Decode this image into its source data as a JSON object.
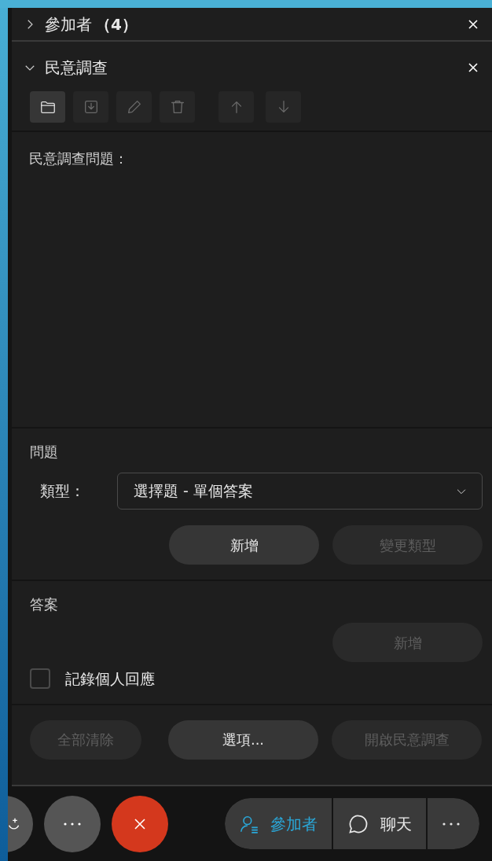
{
  "participants_header": {
    "title": "參加者",
    "count": "（4）",
    "expanded": false
  },
  "poll_header": {
    "title": "民意調查",
    "expanded": true
  },
  "toolbar": [
    {
      "kind": "folder",
      "disabled": false
    },
    {
      "kind": "import",
      "disabled": true
    },
    {
      "kind": "edit",
      "disabled": true
    },
    {
      "kind": "delete",
      "disabled": true
    },
    {
      "kind": "up",
      "disabled": true
    },
    {
      "kind": "down",
      "disabled": true
    }
  ],
  "question_prompt": "民意調查問題：",
  "question": {
    "heading": "問題",
    "type_label": "類型：",
    "type_value": "選擇題 - 單個答案",
    "buttons": [
      {
        "label": "新增",
        "disabled": false
      },
      {
        "label": "變更類型",
        "disabled": true
      }
    ]
  },
  "answers": {
    "heading": "答案",
    "add_button": {
      "label": "新增",
      "disabled": true
    },
    "record_checkbox": {
      "label": "記錄個人回應",
      "checked": false
    }
  },
  "footer_buttons": [
    {
      "label": "全部清除",
      "disabled": true
    },
    {
      "label": "選項...",
      "disabled": false
    },
    {
      "label": "開啟民意調查",
      "disabled": true
    }
  ],
  "call_controls": [
    {
      "kind": "partial"
    },
    {
      "kind": "more"
    },
    {
      "kind": "end"
    }
  ],
  "panel_tabs": [
    {
      "kind": "participants",
      "label": "參加者",
      "selected": true
    },
    {
      "kind": "chat",
      "label": "聊天",
      "selected": false
    },
    {
      "kind": "more",
      "selected": false
    }
  ]
}
